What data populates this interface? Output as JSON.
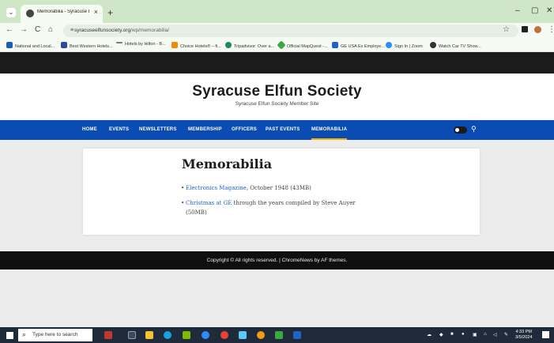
{
  "browser": {
    "tab_title": "Memorabilia - Syracuse Elfun S",
    "tab_close": "×",
    "new_tab": "+",
    "tab_list": "⌄",
    "window_controls": [
      "–",
      "▢",
      "✕"
    ],
    "url_host": "syracuseelfunsociety.org",
    "url_path": "/wp/memorabilia/",
    "nav": [
      "←",
      "→",
      "C",
      "⌂"
    ],
    "bookmarks": [
      {
        "label": "National and Local...",
        "color": "#1a5fb4"
      },
      {
        "label": "Best Western Hotels...",
        "color": "#2b4c9c"
      },
      {
        "label": "Hotels by Hilton - B...",
        "color": "#7a7a7a"
      },
      {
        "label": "Choice Hotels® – fi...",
        "color": "#f08a00"
      },
      {
        "label": "Tripadvisor: Over a...",
        "color": "#1e8c5a"
      },
      {
        "label": "Official MapQuest -...",
        "color": "#3aa845"
      },
      {
        "label": "GE USA Ex Employe...",
        "color": "#1f63c6"
      },
      {
        "label": "Sign In | Zoom",
        "color": "#2d8cff"
      },
      {
        "label": "Watch Car TV Show...",
        "color": "#333333"
      }
    ]
  },
  "site": {
    "title": "Syracuse Elfun Society",
    "tagline": "Syracuse Elfun Society Member Site"
  },
  "nav": {
    "items": [
      "HOME",
      "EVENTS",
      "NEWSLETTERS",
      "MEMBERSHIP",
      "OFFICERS",
      "PAST EVENTS",
      "MEMORABILIA"
    ],
    "active": "MEMORABILIA",
    "accent_color": "#f1b400",
    "bar_color": "#0b4cb4"
  },
  "page": {
    "title": "Memorabilia",
    "items": [
      {
        "link": "Electronics Magazine",
        "text": ", October 1948 (43MB)"
      },
      {
        "link": "Christmas at GE",
        "text": " through the years compiled by Steve Auyer (50MB)"
      }
    ]
  },
  "footer": {
    "copyright": "Copyright © All rights reserved. | ChromeNews by AF themes."
  },
  "taskbar": {
    "search_placeholder": "Type here to search",
    "time": "4:33 PM",
    "date": "3/5/2024"
  }
}
